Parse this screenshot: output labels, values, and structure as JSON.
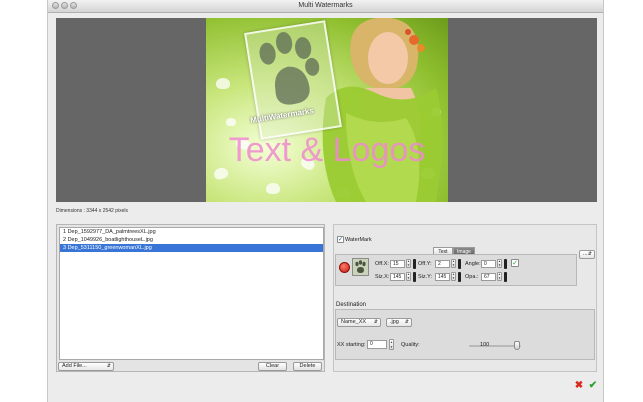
{
  "window": {
    "title": "Multi Watermarks"
  },
  "preview": {
    "watermark_image_text": "MultiWatermarks",
    "watermark_text": "Text & Logos",
    "dimensions": "Dimensions : 3344 x 2542 pixels"
  },
  "files": {
    "items": [
      "1 Dep_1592977_DA_palmtreesXL.jpg",
      "2 Dep_1049926_boatlighthouseL.jpg",
      "3 Dep_5311150_greenwomanXL.jpg"
    ],
    "selected_index": 2,
    "add_file_label": "Add File...",
    "clear_label": "Clear",
    "delete_label": "Delete"
  },
  "watermark": {
    "enabled_label": "WaterMark",
    "enabled": true,
    "tabs": [
      {
        "label": "Text"
      },
      {
        "label": "Image"
      }
    ],
    "active_tab": "Image",
    "off_x_label": "Off.X:",
    "off_x_value": "15",
    "off_y_label": "Off.Y:",
    "off_y_value": "2",
    "angle_label": "Angle:",
    "angle_value": "0",
    "siz_x_label": "Siz.X:",
    "siz_x_value": "145",
    "siz_y_label": "Siz.Y:",
    "siz_y_value": "145",
    "opa_label": "Opa.:",
    "opa_value": "67",
    "more_label": "..."
  },
  "destination": {
    "label": "Destination",
    "name_value": "Name_XX",
    "format_value": ".jpg",
    "xx_starting_label": "XX starting:",
    "xx_starting_value": "0",
    "quality_label": "Quality:",
    "quality_value": "100"
  },
  "colors": {
    "selection": "#3875d7",
    "watermark_text": "#f08ad0",
    "cancel": "#d62a1e",
    "ok": "#2fa12f"
  }
}
